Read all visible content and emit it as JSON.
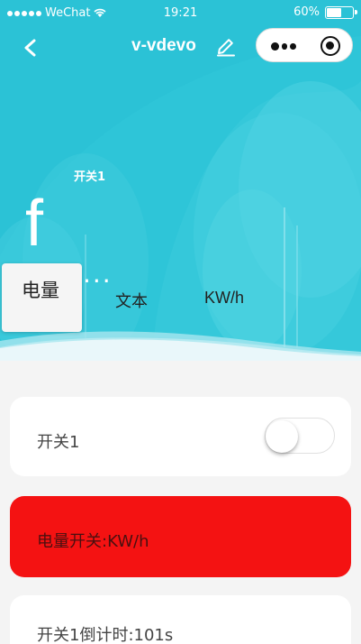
{
  "status_bar": {
    "carrier": "WeChat",
    "time": "19:21",
    "battery": "60%",
    "battery_level": 0.6
  },
  "nav": {
    "title": "v-vdevo",
    "back_icon": "chevron-left-icon",
    "edit_icon": "pencil-icon",
    "more_icon": "more-dots-icon",
    "close_icon": "target-icon"
  },
  "hero": {
    "label": "开关1",
    "big_letter": "f",
    "ellipsis": "...",
    "background": "#2bc2d6"
  },
  "tabs": [
    {
      "label": "电量"
    },
    {
      "label": "文本"
    },
    {
      "label": "KW/h"
    }
  ],
  "cards": {
    "switch": {
      "label": "开关1",
      "on": false
    },
    "power": {
      "label": "电量开关:KW/h",
      "color": "#f41212"
    },
    "timer": {
      "label": "开关1倒计时:101s"
    }
  }
}
